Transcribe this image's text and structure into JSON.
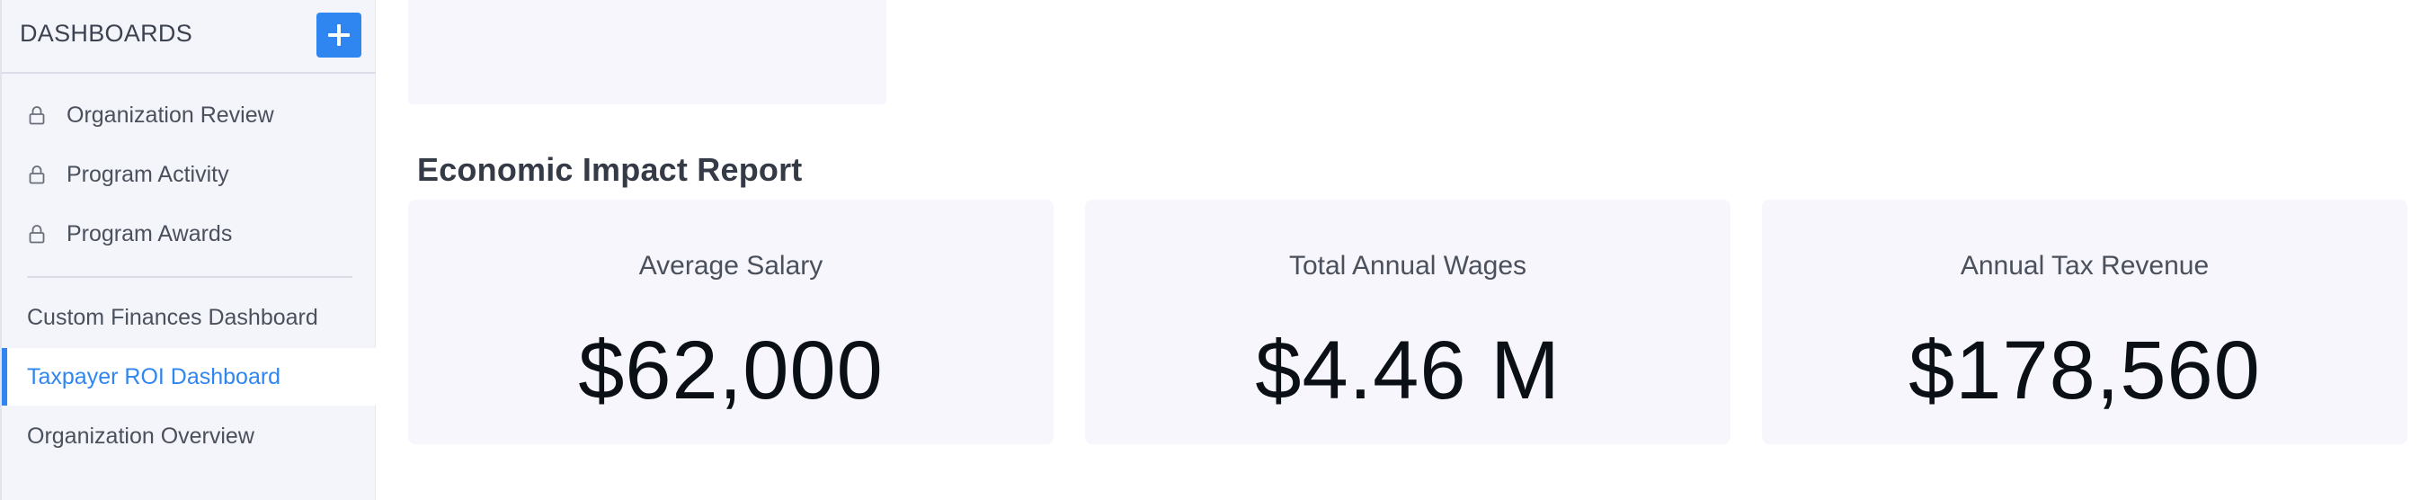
{
  "sidebar": {
    "title": "DASHBOARDS",
    "add_icon": "plus-icon",
    "locked_items": [
      {
        "label": "Organization Review",
        "icon": "lock-icon"
      },
      {
        "label": "Program Activity",
        "icon": "lock-icon"
      },
      {
        "label": "Program Awards",
        "icon": "lock-icon"
      }
    ],
    "items": [
      {
        "label": "Custom Finances Dashboard",
        "active": false
      },
      {
        "label": "Taxpayer ROI Dashboard",
        "active": true
      },
      {
        "label": "Organization Overview",
        "active": false
      }
    ]
  },
  "main": {
    "section_title": "Economic Impact Report",
    "kpis": [
      {
        "label": "Average Salary",
        "value": "$62,000"
      },
      {
        "label": "Total Annual Wages",
        "value": "$4.46 M"
      },
      {
        "label": "Annual Tax Revenue",
        "value": "$178,560"
      }
    ]
  },
  "colors": {
    "accent": "#2f86f0",
    "sidebar_bg": "#f4f4fb",
    "card_bg": "#f6f6fc"
  }
}
